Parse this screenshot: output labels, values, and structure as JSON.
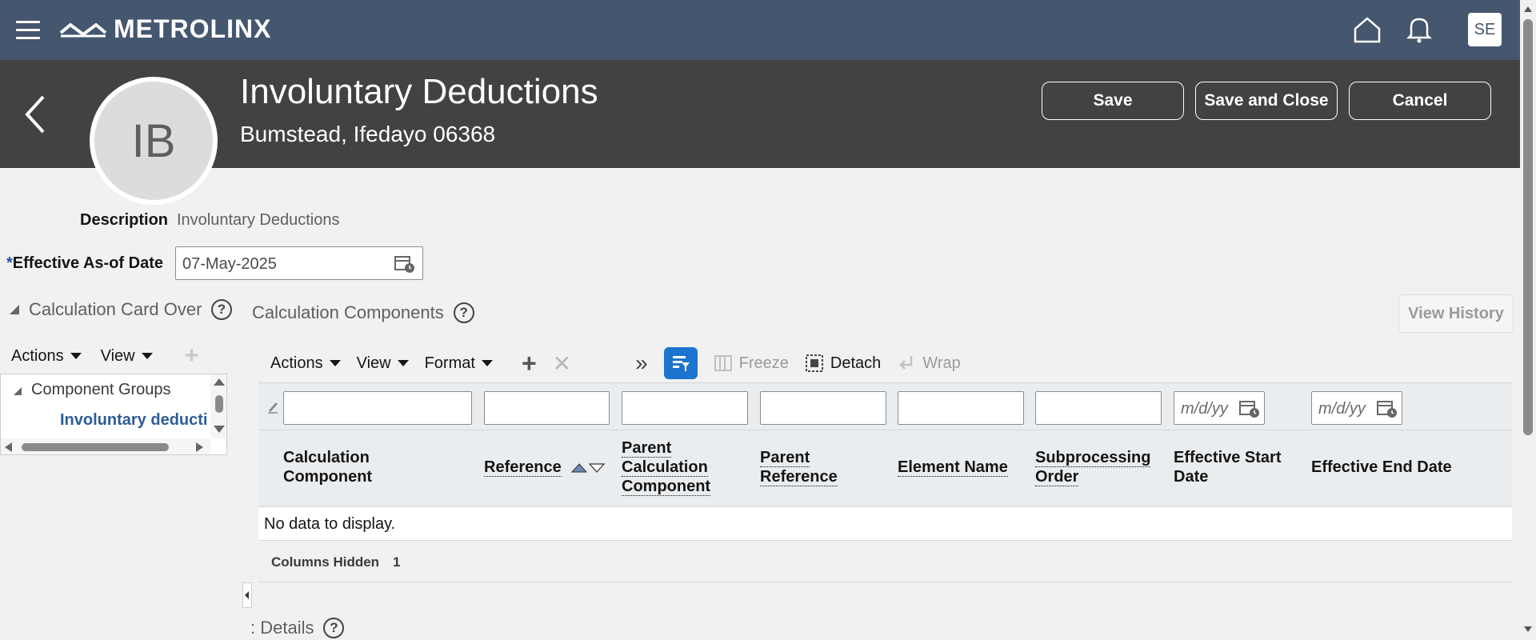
{
  "app": {
    "brand": "METROLINX",
    "user_initials": "SE"
  },
  "header": {
    "avatar_initials": "IB",
    "title": "Involuntary Deductions",
    "subtitle": "Bumstead, Ifedayo 06368",
    "buttons": {
      "save": "Save",
      "save_close": "Save and Close",
      "cancel": "Cancel"
    }
  },
  "form": {
    "description_label": "Description",
    "description_value": "Involuntary Deductions",
    "required_mark": "*",
    "effective_label": "Effective As-of Date",
    "effective_value": "07-May-2025"
  },
  "left_panel": {
    "title": "Calculation Card Over",
    "help": "?",
    "actions": "Actions",
    "view": "View",
    "tree": {
      "group": "Component Groups",
      "child": "Involuntary deducti"
    }
  },
  "main": {
    "title": "Calculation Components",
    "help": "?",
    "view_history": "View History",
    "toolbar": {
      "actions": "Actions",
      "view": "View",
      "format": "Format",
      "freeze": "Freeze",
      "detach": "Detach",
      "wrap": "Wrap"
    },
    "filters": {
      "date_placeholder": "m/d/yy"
    },
    "columns": [
      "Calculation Component",
      "Reference",
      "Parent Calculation Component",
      "Parent Reference",
      "Element Name",
      "Subprocessing Order",
      "Effective Start Date",
      "Effective End Date"
    ],
    "no_data": "No data to display.",
    "columns_hidden_label": "Columns Hidden",
    "columns_hidden_count": "1",
    "details_title": ": Details",
    "details_help": "?"
  },
  "colors": {
    "topbar": "#45566f",
    "header": "#424242",
    "accent": "#1b74cd",
    "link": "#2e5d95"
  }
}
